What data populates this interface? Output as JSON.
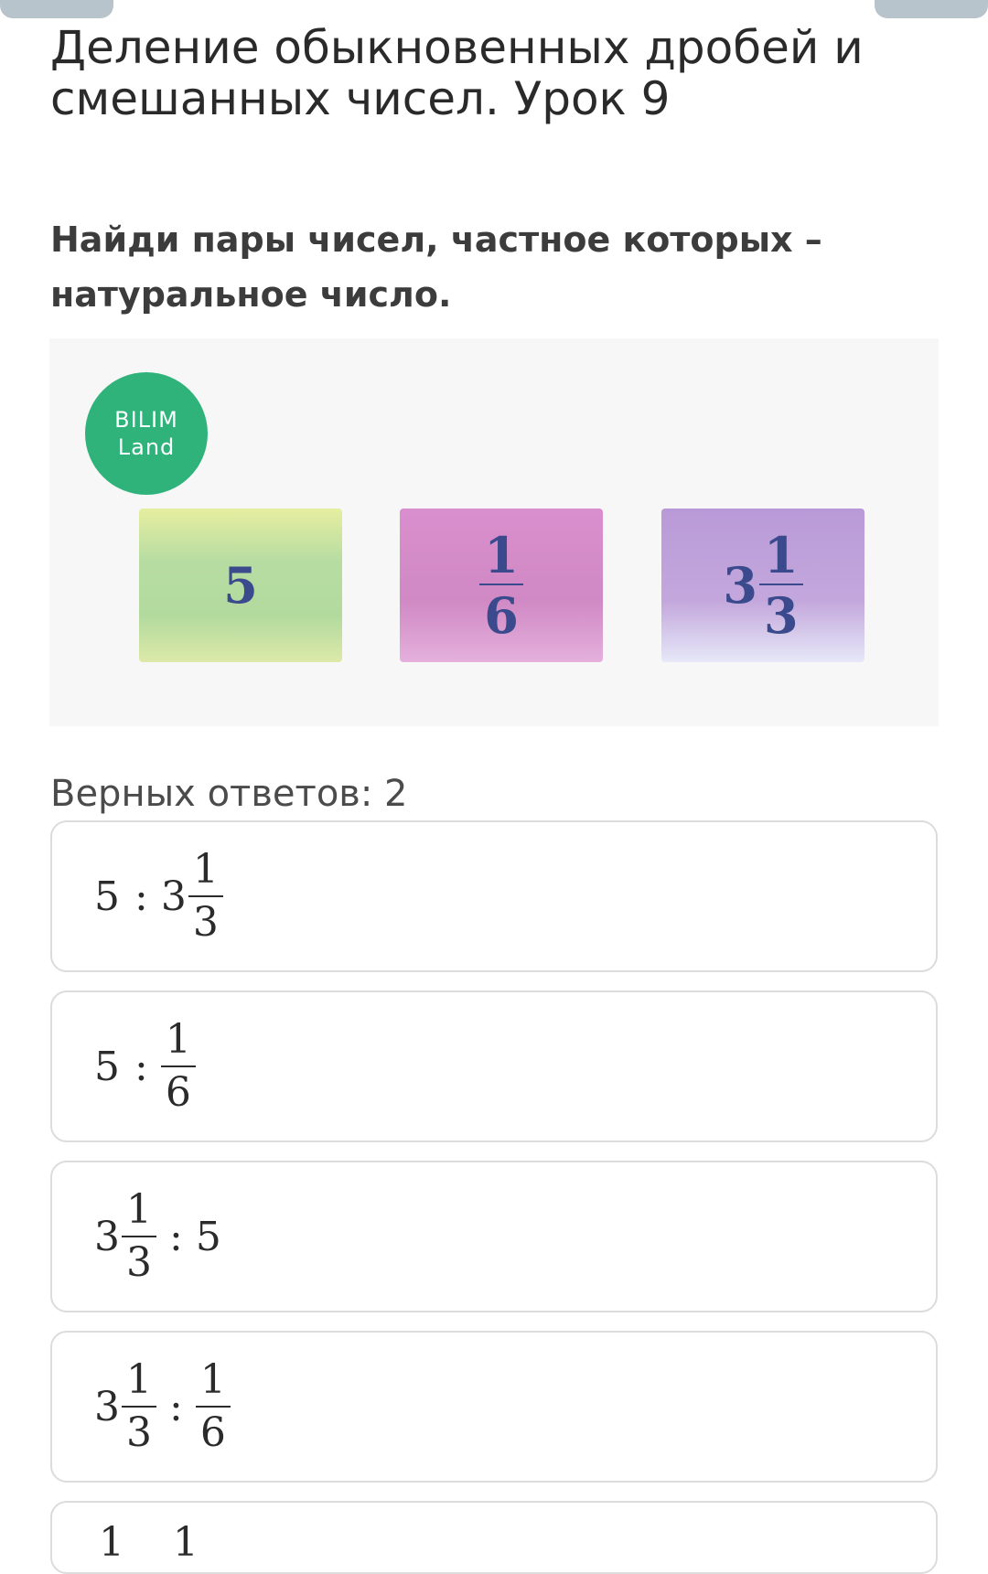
{
  "lesson": {
    "title": "Деление обыкновенных дробей и смешанных чисел. Урок 9"
  },
  "question": {
    "text": "Найди пары чисел, частное которых – натуральное число."
  },
  "image": {
    "logo_line1": "BILIM",
    "logo_line2": "Land",
    "logo_color": "#2fb37a",
    "cards": [
      {
        "value": "5",
        "color": "#b6dca2"
      },
      {
        "numerator": "1",
        "denominator": "6",
        "color": "#d089c4"
      },
      {
        "whole": "3",
        "numerator": "1",
        "denominator": "3",
        "color": "#c3a7dc"
      }
    ]
  },
  "answers": {
    "correct_count_label": "Верных ответов: 2",
    "options": [
      {
        "left": {
          "whole": "5"
        },
        "op": ":",
        "right": {
          "whole": "3",
          "numerator": "1",
          "denominator": "3"
        }
      },
      {
        "left": {
          "whole": "5"
        },
        "op": ":",
        "right": {
          "numerator": "1",
          "denominator": "6"
        }
      },
      {
        "left": {
          "whole": "3",
          "numerator": "1",
          "denominator": "3"
        },
        "op": ":",
        "right": {
          "whole": "5"
        }
      },
      {
        "left": {
          "whole": "3",
          "numerator": "1",
          "denominator": "3"
        },
        "op": ":",
        "right": {
          "numerator": "1",
          "denominator": "6"
        }
      },
      {
        "left": {
          "numerator": "1"
        },
        "right": {
          "numerator": "1"
        }
      }
    ]
  }
}
